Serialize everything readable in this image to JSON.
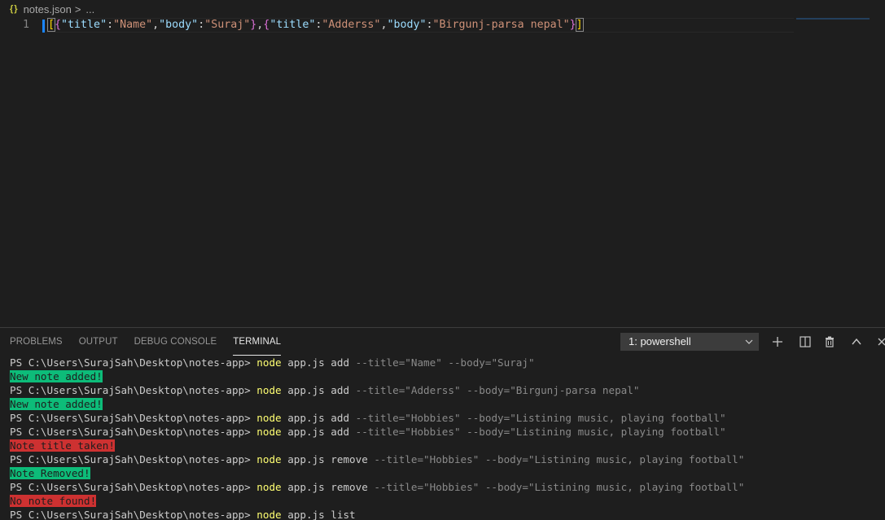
{
  "breadcrumb": {
    "icon_text": "{}",
    "file": "notes.json",
    "chevron": ">",
    "ellipsis": "..."
  },
  "editor": {
    "line_number": "1",
    "tokens": {
      "open_bracket": "[",
      "open_brace_1": "{",
      "key_title_1": "\"title\"",
      "colon_1": ":",
      "val_title_1": "\"Name\"",
      "comma_1": ",",
      "key_body_1": "\"body\"",
      "colon_2": ":",
      "val_body_1": "\"Suraj\"",
      "close_brace_1": "}",
      "comma_2": ",",
      "open_brace_2": "{",
      "key_title_2": "\"title\"",
      "colon_3": ":",
      "val_title_2": "\"Adderss\"",
      "comma_3": ",",
      "key_body_2": "\"body\"",
      "colon_4": ":",
      "val_body_2": "\"Birgunj-parsa nepal\"",
      "close_brace_2": "}",
      "close_bracket": "]"
    }
  },
  "panel": {
    "tabs": [
      {
        "label": "PROBLEMS"
      },
      {
        "label": "OUTPUT"
      },
      {
        "label": "DEBUG CONSOLE"
      },
      {
        "label": "TERMINAL"
      }
    ],
    "terminal_select": "1: powershell",
    "actions": {
      "add": "+",
      "split": "◫",
      "trash": "🗑",
      "maximize": "^",
      "close": "×"
    }
  },
  "terminal": {
    "prompt": "PS C:\\Users\\SurajSah\\Desktop\\notes-app> ",
    "lines": [
      {
        "node": "node",
        "args": " app.js add ",
        "flags": "--title=\"Name\" --body=\"Suraj\""
      },
      {
        "message": "New note added!"
      },
      {
        "node": "node",
        "args": " app.js add ",
        "flags": "--title=\"Adderss\" --body=\"Birgunj-parsa nepal\""
      },
      {
        "message": "New note added!"
      },
      {
        "node": "node",
        "args": " app.js add ",
        "flags": "--title=\"Hobbies\" --body=\"Listining music, playing football\""
      },
      {
        "node": "node",
        "args": " app.js add ",
        "flags": "--title=\"Hobbies\" --body=\"Listining music, playing football\""
      },
      {
        "message": "Note title taken!"
      },
      {
        "node": "node",
        "args": " app.js remove ",
        "flags": "--title=\"Hobbies\" --body=\"Listining music, playing football\""
      },
      {
        "message": "Note Removed!"
      },
      {
        "node": "node",
        "args": " app.js remove ",
        "flags": "--title=\"Hobbies\" --body=\"Listining music, playing football\""
      },
      {
        "message": "No note found!"
      },
      {
        "node": "node",
        "args": " app.js list",
        "flags": ""
      }
    ]
  },
  "colors": {
    "success_badge": "#0dbc79",
    "error_badge": "#cd3131",
    "command": "#ffff72",
    "accent": "#1a85ff"
  }
}
